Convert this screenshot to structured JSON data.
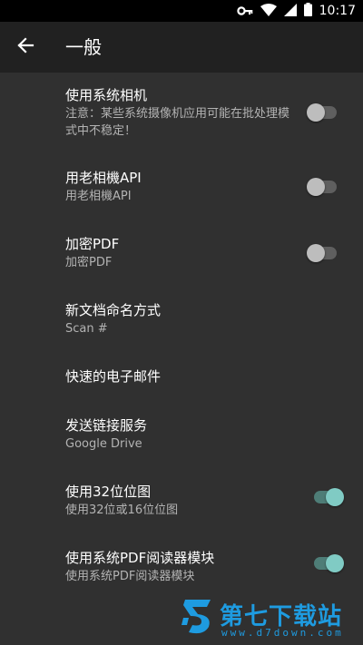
{
  "status_bar": {
    "time": "10:17",
    "icons": [
      "key-icon",
      "wifi-icon",
      "signal-icon",
      "battery-icon"
    ]
  },
  "app_bar": {
    "back_icon": "arrow-back-icon",
    "title": "一般"
  },
  "colors": {
    "app_bar": "#212121",
    "background": "#303030",
    "status_bar": "#000000",
    "switch_on_thumb": "#80cbc4",
    "switch_on_track": "#4e7d77",
    "switch_off_thumb": "#bdbdbd",
    "switch_off_track": "#5f5f5f",
    "watermark": "#1e9be0"
  },
  "settings": [
    {
      "title": "使用系统相机",
      "summary": "注意：某些系统摄像机应用可能在批处理模式中不稳定！",
      "has_switch": true,
      "checked": false
    },
    {
      "title": "用老相機API",
      "summary": "用老相機API",
      "has_switch": true,
      "checked": false
    },
    {
      "title": "加密PDF",
      "summary": "加密PDF",
      "has_switch": true,
      "checked": false
    },
    {
      "title": "新文档命名方式",
      "summary": "Scan #",
      "has_switch": false
    },
    {
      "title": "快速的电子邮件",
      "summary": "",
      "has_switch": false
    },
    {
      "title": "发送链接服务",
      "summary": "Google Drive",
      "has_switch": false
    },
    {
      "title": "使用32位位图",
      "summary": "使用32位或16位位图",
      "has_switch": true,
      "checked": true
    },
    {
      "title": "使用系统PDF阅读器模块",
      "summary": "使用系统PDF阅读器模块",
      "has_switch": true,
      "checked": true
    }
  ],
  "watermark": {
    "brand": "第七下载站",
    "url": "www.d7down.com"
  }
}
